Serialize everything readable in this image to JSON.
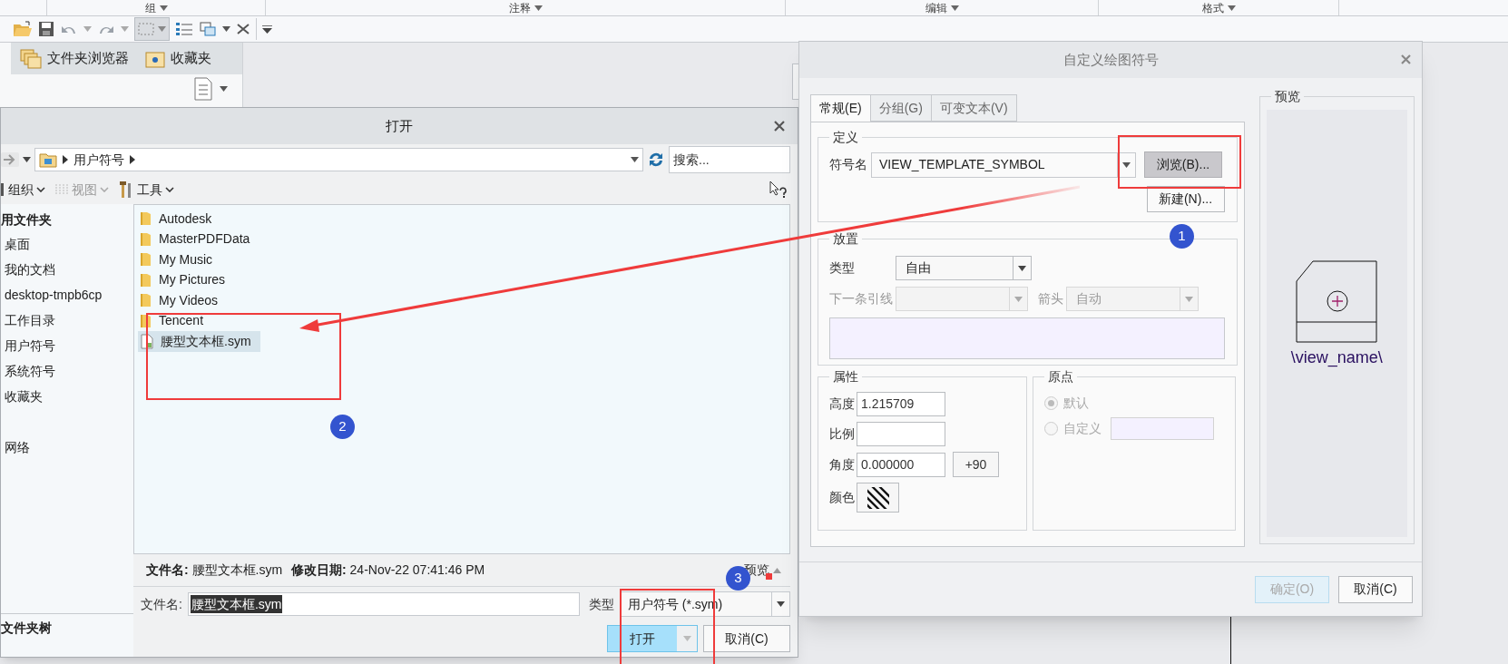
{
  "ribbon": {
    "groups": [
      {
        "label": "组"
      },
      {
        "label": "注释"
      },
      {
        "label": "编辑"
      },
      {
        "label": "格式"
      }
    ]
  },
  "browser_panel": {
    "tabs": [
      {
        "label": "文件夹浏览器"
      },
      {
        "label": "收藏夹"
      }
    ]
  },
  "open_dialog": {
    "title": "打开",
    "address": {
      "path": "用户符号"
    },
    "search": {
      "placeholder": "搜索..."
    },
    "toolbar": [
      {
        "label": "组织",
        "disabled": false
      },
      {
        "label": "视图",
        "disabled": true
      },
      {
        "label": "工具",
        "disabled": false
      }
    ],
    "sidebar": {
      "heading": "用文件夹",
      "items": [
        {
          "label": "桌面"
        },
        {
          "label": "我的文档"
        },
        {
          "label": "desktop-tmpb6cp"
        },
        {
          "label": "工作目录"
        },
        {
          "label": "用户符号"
        },
        {
          "label": "系统符号"
        },
        {
          "label": "收藏夹"
        },
        {
          "label": "网络"
        }
      ],
      "footer": "文件夹树"
    },
    "files": [
      {
        "name": "Autodesk",
        "kind": "folder",
        "selected": false
      },
      {
        "name": "MasterPDFData",
        "kind": "folder",
        "selected": false
      },
      {
        "name": "My Music",
        "kind": "folder",
        "selected": false
      },
      {
        "name": "My Pictures",
        "kind": "folder",
        "selected": false
      },
      {
        "name": "My Videos",
        "kind": "folder",
        "selected": false
      },
      {
        "name": "Tencent",
        "kind": "folder",
        "selected": false
      },
      {
        "name": "腰型文本框.sym",
        "kind": "file",
        "selected": true
      }
    ],
    "details": {
      "name_label": "文件名:",
      "name": "腰型文本框.sym",
      "date_label": "修改日期:",
      "date": "24-Nov-22 07:41:46 PM"
    },
    "preview_toggle": "预览",
    "filename": {
      "label": "文件名:",
      "value": "腰型文本框.sym"
    },
    "type": {
      "label": "类型",
      "value": "用户符号 (*.sym)"
    },
    "buttons": [
      {
        "label": "打开",
        "kind": "primary"
      },
      {
        "label": "取消(C)",
        "kind": "normal"
      }
    ]
  },
  "symbol_dialog": {
    "title": "自定义绘图符号",
    "tabs": [
      {
        "label": "常规(E)",
        "selected": true
      },
      {
        "label": "分组(G)",
        "selected": false
      },
      {
        "label": "可变文本(V)",
        "selected": false
      }
    ],
    "definition": {
      "title": "定义",
      "name_label": "符号名",
      "name_value": "VIEW_TEMPLATE_SYMBOL",
      "browse": "浏览(B)...",
      "new": "新建(N)..."
    },
    "placement": {
      "title": "放置",
      "type_label": "类型",
      "type_value": "自由",
      "leader_label": "下一条引线",
      "arrow_label": "箭头",
      "arrow_value": "自动"
    },
    "attributes": {
      "title": "属性",
      "height_label": "高度",
      "height_value": "1.215709",
      "scale_label": "比例",
      "angle_label": "角度",
      "angle_value": "0.000000",
      "rotate": "+90",
      "color_label": "颜色"
    },
    "origin": {
      "title": "原点",
      "options": [
        {
          "label": "默认",
          "checked": true
        },
        {
          "label": "自定义",
          "checked": false
        }
      ]
    },
    "preview": {
      "title": "预览",
      "symbol_text": "\\view_name\\"
    },
    "buttons": [
      {
        "label": "确定(O)",
        "disabled": true
      },
      {
        "label": "取消(C)",
        "disabled": false
      }
    ]
  },
  "annotations": {
    "badges": [
      {
        "label": "1"
      },
      {
        "label": "2"
      },
      {
        "label": "3"
      }
    ]
  }
}
